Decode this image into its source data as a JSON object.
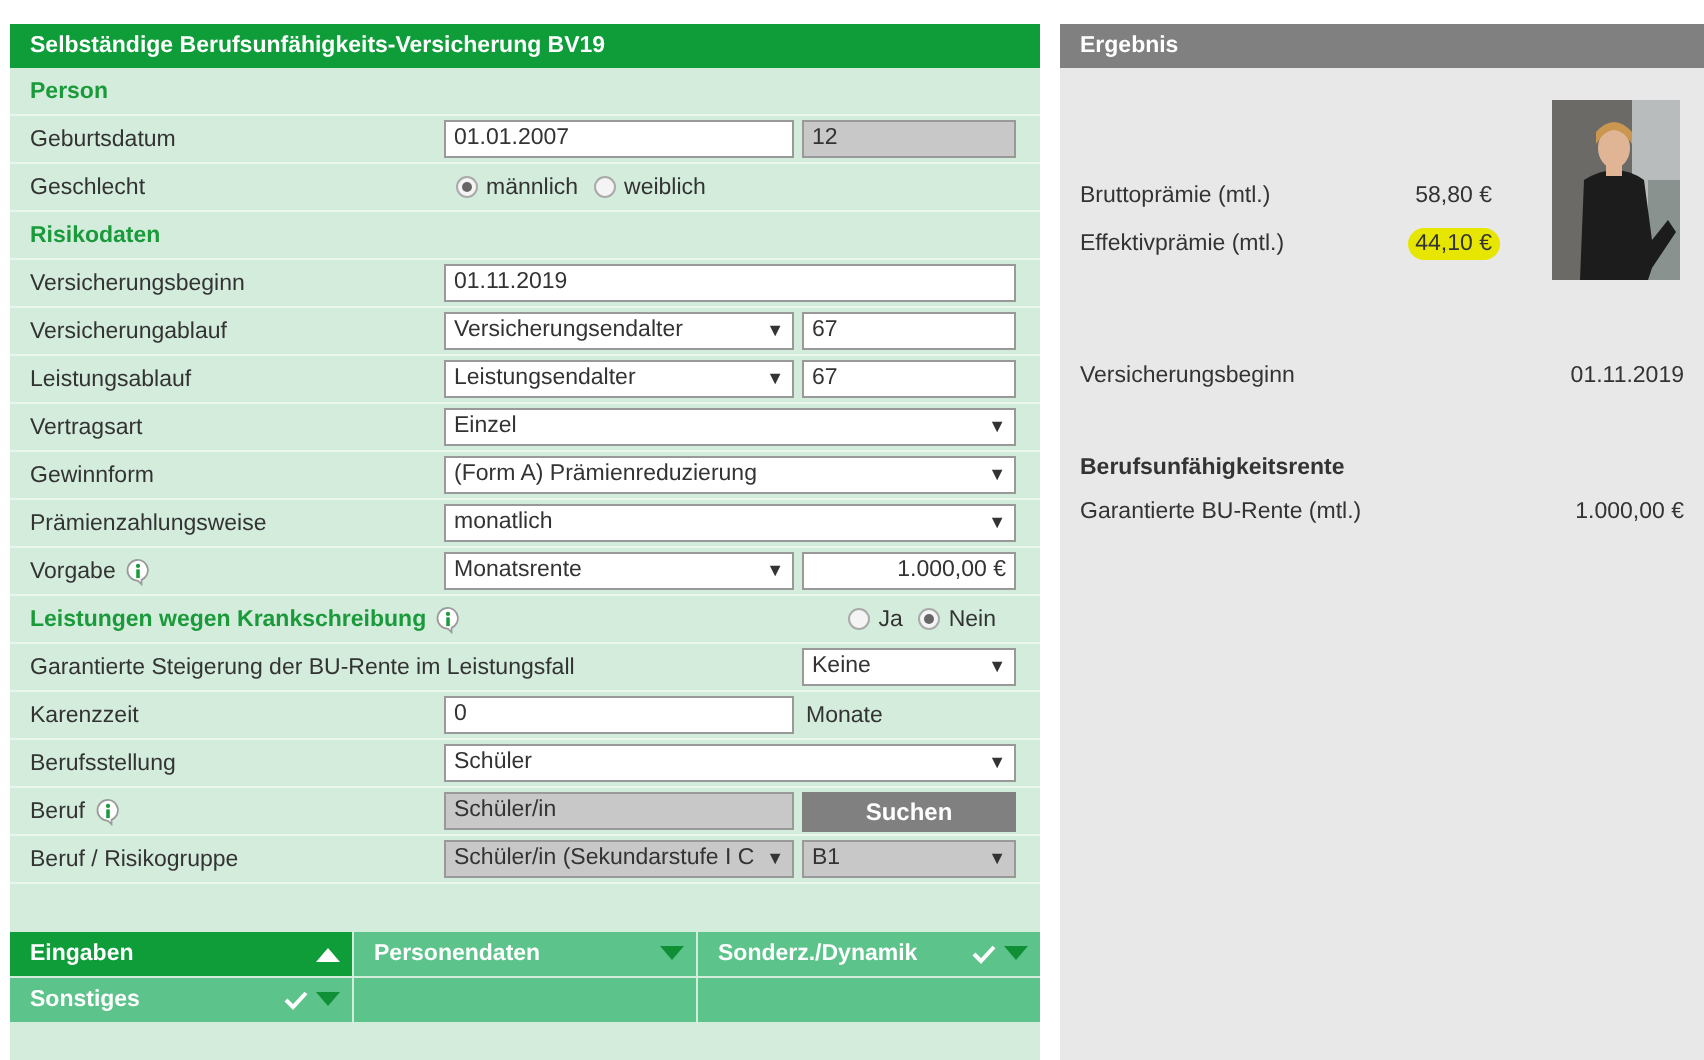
{
  "form": {
    "title": "Selbständige Berufsunfähigkeits-Versicherung BV19",
    "rows": [
      {
        "kind": "section",
        "label": "Person"
      },
      {
        "kind": "field",
        "label": "Geburtsdatum",
        "controls": [
          {
            "kind": "input",
            "value": "01.01.2007"
          },
          {
            "kind": "readonly",
            "value": "12"
          }
        ]
      },
      {
        "kind": "field",
        "label": "Geschlecht",
        "controls": [
          {
            "kind": "radios",
            "options": [
              {
                "label": "männlich",
                "selected": true
              },
              {
                "label": "weiblich",
                "selected": false
              }
            ]
          }
        ]
      },
      {
        "kind": "section",
        "label": "Risikodaten"
      },
      {
        "kind": "field",
        "label": "Versicherungsbeginn",
        "controls": [
          {
            "kind": "input",
            "value": "01.11.2019"
          }
        ]
      },
      {
        "kind": "field",
        "label": "Versicherungablauf",
        "controls": [
          {
            "kind": "select",
            "value": "Versicherungsendalter",
            "arrow": "▼"
          },
          {
            "kind": "input",
            "value": "67"
          }
        ]
      },
      {
        "kind": "field",
        "label": "Leistungsablauf",
        "controls": [
          {
            "kind": "select",
            "value": "Leistungsendalter",
            "arrow": "▼"
          },
          {
            "kind": "input",
            "value": "67"
          }
        ]
      },
      {
        "kind": "field",
        "label": "Vertragsart",
        "controls": [
          {
            "kind": "select",
            "value": "Einzel",
            "arrow": "▼"
          }
        ]
      },
      {
        "kind": "field",
        "label": "Gewinnform",
        "controls": [
          {
            "kind": "select",
            "value": "(Form A) Prämienreduzierung",
            "arrow": "▼"
          }
        ]
      },
      {
        "kind": "field",
        "label": "Prämienzahlungsweise",
        "controls": [
          {
            "kind": "select",
            "value": "monatlich",
            "arrow": "▼"
          }
        ]
      },
      {
        "kind": "field",
        "label": "Vorgabe",
        "info": true,
        "controls": [
          {
            "kind": "select",
            "value": "Monatsrente",
            "arrow": "▼"
          },
          {
            "kind": "amount",
            "value": "1.000,00 €"
          }
        ]
      },
      {
        "kind": "section",
        "label": "Leistungen wegen Krankschreibung",
        "info": true,
        "controls": [
          {
            "kind": "radios",
            "options": [
              {
                "label": "Ja",
                "selected": false
              },
              {
                "label": "Nein",
                "selected": true
              }
            ]
          }
        ]
      },
      {
        "kind": "long",
        "label": "Garantierte Steigerung der BU-Rente im Leistungsfall",
        "controls": [
          {
            "kind": "select",
            "value": "Keine",
            "arrow": "▼"
          }
        ]
      },
      {
        "kind": "field",
        "label": "Karenzzeit",
        "controls": [
          {
            "kind": "input",
            "value": "0"
          },
          {
            "kind": "unit",
            "value": "Monate"
          }
        ]
      },
      {
        "kind": "field",
        "label": "Berufsstellung",
        "controls": [
          {
            "kind": "select",
            "value": "Schüler",
            "arrow": "▼"
          }
        ]
      },
      {
        "kind": "field",
        "label": "Beruf",
        "info": true,
        "controls": [
          {
            "kind": "readonly",
            "value": "Schüler/in"
          },
          {
            "kind": "button",
            "value": "Suchen"
          }
        ]
      },
      {
        "kind": "field",
        "label": "Beruf / Risikogruppe",
        "controls": [
          {
            "kind": "readonly-select",
            "value": "Schüler/in (Sekundarstufe I C",
            "arrow": "▼"
          },
          {
            "kind": "readonly-select",
            "value": "B1",
            "arrow": "▼"
          }
        ]
      }
    ],
    "tabs": [
      {
        "label": "Eingaben",
        "selected": true,
        "checked": false
      },
      {
        "label": "Personendaten",
        "selected": false,
        "checked": false
      },
      {
        "label": "Sonderz./Dynamik",
        "selected": false,
        "checked": true
      },
      {
        "label": "Sonstiges",
        "selected": false,
        "checked": true
      }
    ]
  },
  "result": {
    "title": "Ergebnis",
    "premiums": [
      {
        "label": "Bruttoprämie (mtl.)",
        "value": "58,80",
        "currency": "€",
        "highlighted": false
      },
      {
        "label": "Effektivprämie (mtl.)",
        "value": "44,10",
        "currency": "€",
        "highlighted": true
      }
    ],
    "start": {
      "label": "Versicherungsbeginn",
      "value": "01.11.2019"
    },
    "section": "Berufsunfähigkeitsrente",
    "pension": {
      "label": "Garantierte BU-Rente (mtl.)",
      "value": "1.000,00",
      "currency": "€"
    }
  }
}
